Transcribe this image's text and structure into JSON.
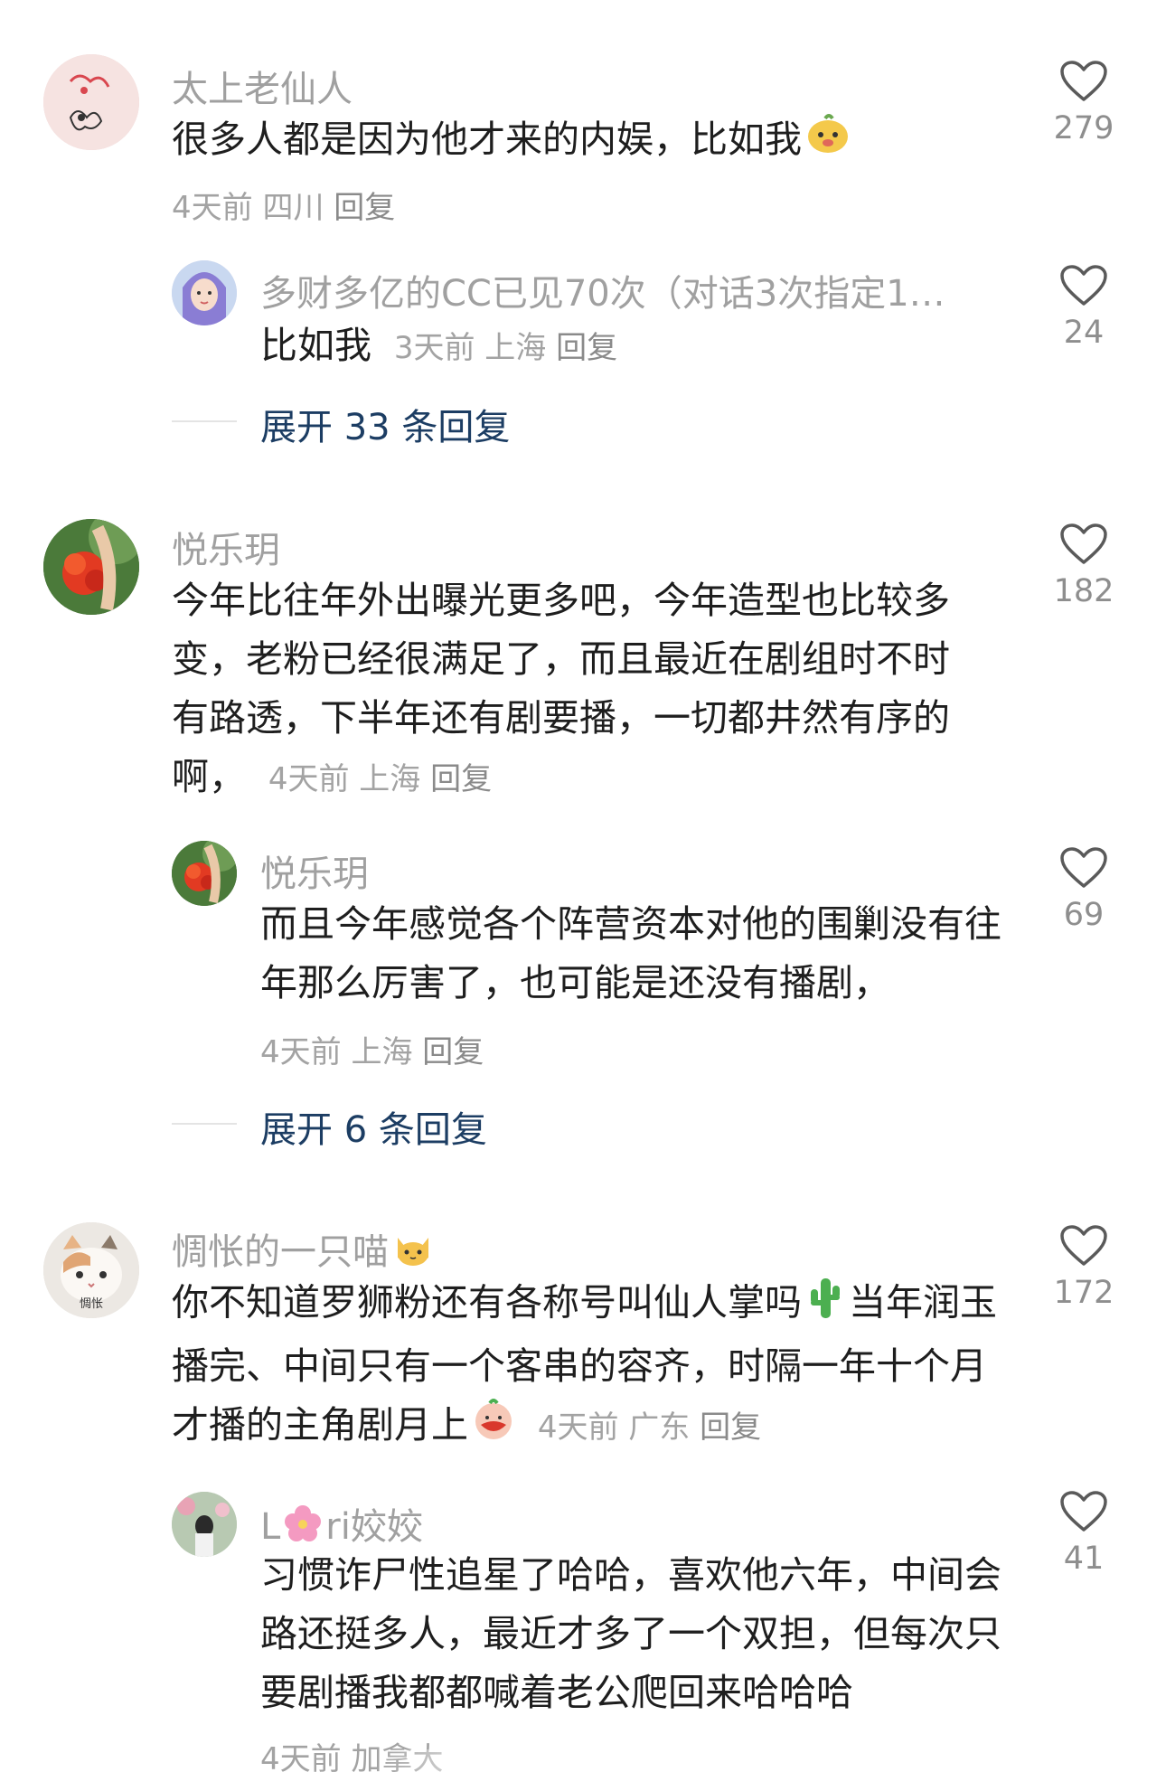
{
  "comments": [
    {
      "user": "太上老仙人",
      "text": "很多人都是因为他才来的内娱，比如我",
      "time": "4天前",
      "location": "四川",
      "reply_label": "回复",
      "likes": "279",
      "replies": [
        {
          "user": "多财多亿的CC已见70次（对话3次指定1…",
          "text": "比如我",
          "time": "3天前",
          "location": "上海",
          "reply_label": "回复",
          "likes": "24"
        }
      ],
      "expand_label": "展开 33 条回复"
    },
    {
      "user": "悦乐玥",
      "text": "今年比往年外出曝光更多吧，今年造型也比较多变，老粉已经很满足了，而且最近在剧组时不时有路透，下半年还有剧要播，一切都井然有序的啊，",
      "time": "4天前",
      "location": "上海",
      "reply_label": "回复",
      "likes": "182",
      "replies": [
        {
          "user": "悦乐玥",
          "text": "而且今年感觉各个阵营资本对他的围剿没有往年那么厉害了，也可能是还没有播剧，",
          "time": "4天前",
          "location": "上海",
          "reply_label": "回复",
          "likes": "69"
        }
      ],
      "expand_label": "展开 6 条回复"
    },
    {
      "user": "惆怅的一只喵",
      "avatar_caption": "惆怅",
      "text_a": "你不知道罗狮粉还有各称号叫仙人掌吗",
      "text_b": "当年润玉播完、中间只有一个客串的容齐，时隔一年十个月才播的主角剧月上",
      "time": "4天前",
      "location": "广东",
      "reply_label": "回复",
      "likes": "172",
      "replies": [
        {
          "user_a": "L",
          "user_b": "ri姣姣",
          "text": "习惯诈尸性追星了哈哈，喜欢他六年，中间会路还挺多人，最近才多了一个双担，但每次只要剧播我都都喊着老公爬回来哈哈哈",
          "time": "4天前",
          "location": "加拿大",
          "likes": "41"
        }
      ]
    }
  ],
  "colors": {
    "name_gray": "#a0a0a0",
    "text": "#1e1e1e",
    "expand_blue": "#1c3d63",
    "meta_gray": "#a3a3a3"
  },
  "icons": [
    "heart-outline-icon",
    "face-emoji",
    "cactus-emoji",
    "cat-emoji",
    "flower-emoji",
    "moustache-face-emoji"
  ]
}
